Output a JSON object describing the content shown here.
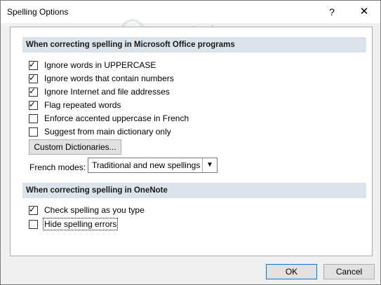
{
  "window": {
    "title": "Spelling Options",
    "help_glyph": "?",
    "close_glyph": "✕"
  },
  "office_section": {
    "header": "When correcting spelling in Microsoft Office programs",
    "options": [
      {
        "label": "Ignore words in UPPERCASE",
        "checked": true
      },
      {
        "label": "Ignore words that contain numbers",
        "checked": true
      },
      {
        "label": "Ignore Internet and file addresses",
        "checked": true
      },
      {
        "label": "Flag repeated words",
        "checked": true
      },
      {
        "label": "Enforce accented uppercase in French",
        "checked": false
      },
      {
        "label": "Suggest from main dictionary only",
        "checked": false
      }
    ],
    "custom_dictionaries_label": "Custom Dictionaries...",
    "french_modes_label": "French modes:",
    "french_modes_value": "Traditional and new spellings"
  },
  "onenote_section": {
    "header": "When correcting spelling in OneNote",
    "options": [
      {
        "label": "Check spelling as you type",
        "checked": true
      },
      {
        "label": "Hide spelling errors",
        "checked": false
      }
    ]
  },
  "footer": {
    "ok_label": "OK",
    "cancel_label": "Cancel"
  },
  "watermark": {
    "text": "uantrimang"
  },
  "colors": {
    "section_header_bg": "#dde3ea",
    "dialog_bg": "#f0f0f0",
    "ok_border": "#0078d7"
  }
}
